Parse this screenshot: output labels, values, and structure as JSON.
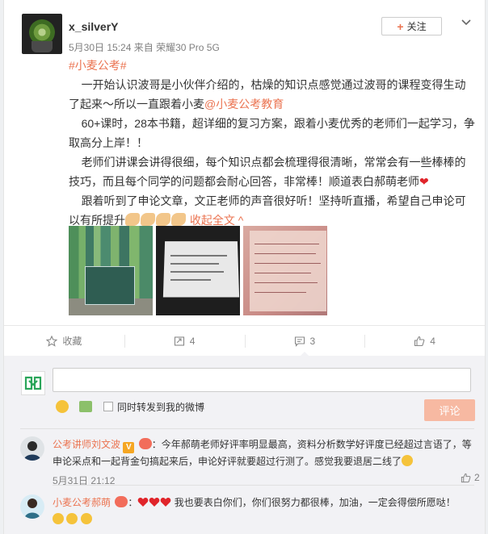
{
  "post": {
    "username": "x_silverY",
    "timestamp": "5月30日 15:24",
    "source_prefix": "来自",
    "device": "荣耀30 Pro 5G",
    "follow_label": "关注",
    "topic": "#小麦公考#",
    "para1_a": "一开始认识波哥是小伙伴介绍的，枯燥的知识点感觉通过波哥的课程变得生动了起来～所以一直跟着小麦",
    "mention": "@小麦公考教育",
    "para2": "60+课时，28本书籍，超详细的复习方案，跟着小麦优秀的老师们一起学习，争取高分上岸！！",
    "para3": "老师们讲课会讲得很细，每个知识点都会梳理得很清晰，常常会有一些棒棒的技巧，而且每个同学的问题都会耐心回答，非常棒！顺道表白郝萌老师",
    "para4": "跟着听到了申论文章，文正老师的声音很好听！坚持听直播，希望自己申论可以有所提升",
    "collapse_label": "收起全文"
  },
  "images": [
    {
      "icon": "books-photo"
    },
    {
      "icon": "screen-photo"
    },
    {
      "icon": "notes-photo"
    }
  ],
  "actions": {
    "favorite_label": "收藏",
    "repost_count": "4",
    "comment_count": "3",
    "like_count": "4"
  },
  "composer": {
    "forward_label": "同时转发到我的微博",
    "submit_label": "评论"
  },
  "comments": [
    {
      "name": "公考讲师刘文波",
      "text": "：今年郝萌老师好评率明显最高，资料分析数学好评度已经超过言语了，等申论采点和一起背金句搞起来后，申论好评就要超过行测了。感觉我要退居二线了",
      "time": "5月31日 21:12",
      "likes": "2"
    },
    {
      "name": "小麦公考郝萌",
      "text_a": "：",
      "text_b": " 我也要表白你们，你们很努力都很棒，加油，一定会得偿所愿哒！"
    }
  ],
  "colors": {
    "accent": "#eb7350",
    "heart": "#e0242a",
    "muted": "#808080"
  }
}
